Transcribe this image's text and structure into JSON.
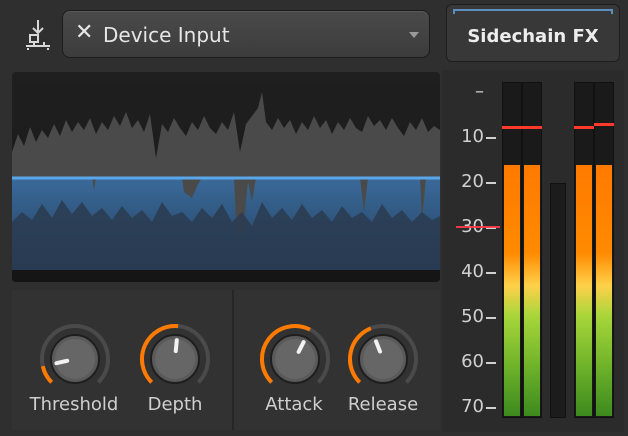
{
  "header": {
    "routing_icon": "input-routing-icon",
    "device_select": {
      "clear_glyph": "✕",
      "label": "Device Input",
      "caret": "chevron-down-icon"
    },
    "sidechain_button": {
      "label": "Sidechain FX",
      "accent_color": "#5c8fbf"
    }
  },
  "knobs": [
    {
      "name": "threshold",
      "label": "Threshold",
      "value": 0.12
    },
    {
      "name": "depth",
      "label": "Depth",
      "value": 0.52
    },
    {
      "name": "attack",
      "label": "Attack",
      "value": 0.6
    },
    {
      "name": "release",
      "label": "Release",
      "value": 0.42
    }
  ],
  "meter_scale": [
    "–",
    "10",
    "20",
    "30",
    "40",
    "50",
    "60",
    "70"
  ],
  "meters": {
    "left_pair": [
      {
        "level": 0.75,
        "peak": 0.87
      },
      {
        "level": 0.75,
        "peak": 0.87
      }
    ],
    "sidechain": {
      "level": 0.7
    },
    "right_pair": [
      {
        "level": 0.75,
        "peak": 0.87
      },
      {
        "level": 0.75,
        "peak": 0.88
      }
    ]
  },
  "colors": {
    "accent_orange": "#ff7a00",
    "waveform_blue": "#4e9be0",
    "peak_red": "#ff3a2a"
  }
}
